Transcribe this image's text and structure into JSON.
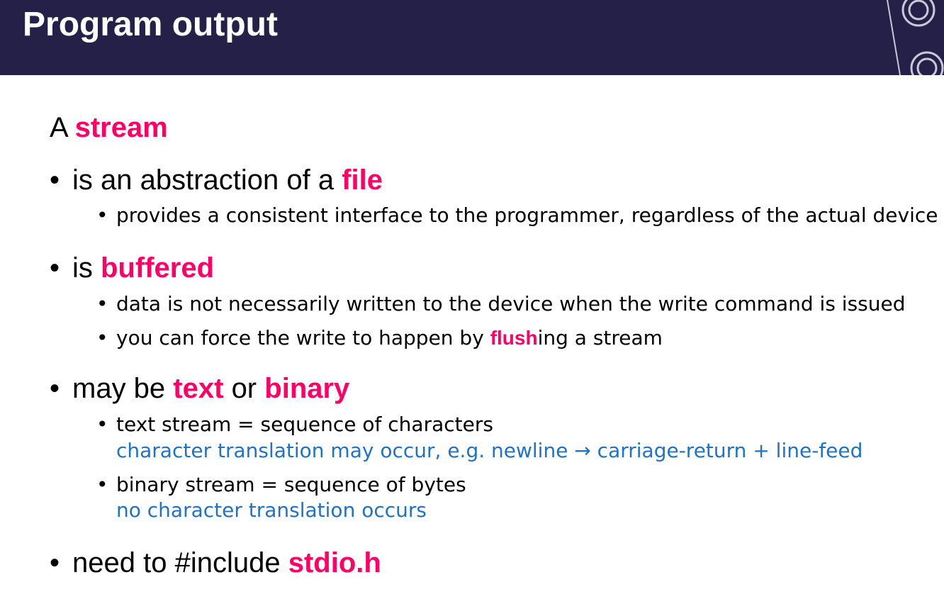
{
  "header": {
    "title": "Program output"
  },
  "colors": {
    "header_bg": "#242048",
    "highlight": "#ff0066",
    "note": "#1e73c9"
  },
  "intro": {
    "pre": "A",
    "hl": "stream"
  },
  "b1": {
    "pre": "is an abstraction of a",
    "hl": "file",
    "sub1": "provides a consistent interface to the programmer, regardless of the actual device"
  },
  "b2": {
    "pre": "is",
    "hl": "buffered",
    "sub1": "data is not necessarily written to the device when the write command is issued",
    "sub2_pre": "you can force the write to happen by",
    "sub2_hl": "flush",
    "sub2_post": "ing a stream"
  },
  "b3": {
    "pre": "may be",
    "hl1": "text",
    "mid": "or",
    "hl2": "binary",
    "sub1": "text stream = sequence of characters",
    "sub1_note": "character translation may occur, e.g. newline → carriage-return + line-feed",
    "sub2": "binary stream = sequence of bytes",
    "sub2_note": "no character translation occurs"
  },
  "b4": {
    "pre": "need to #include",
    "hl": "stdio.h"
  }
}
